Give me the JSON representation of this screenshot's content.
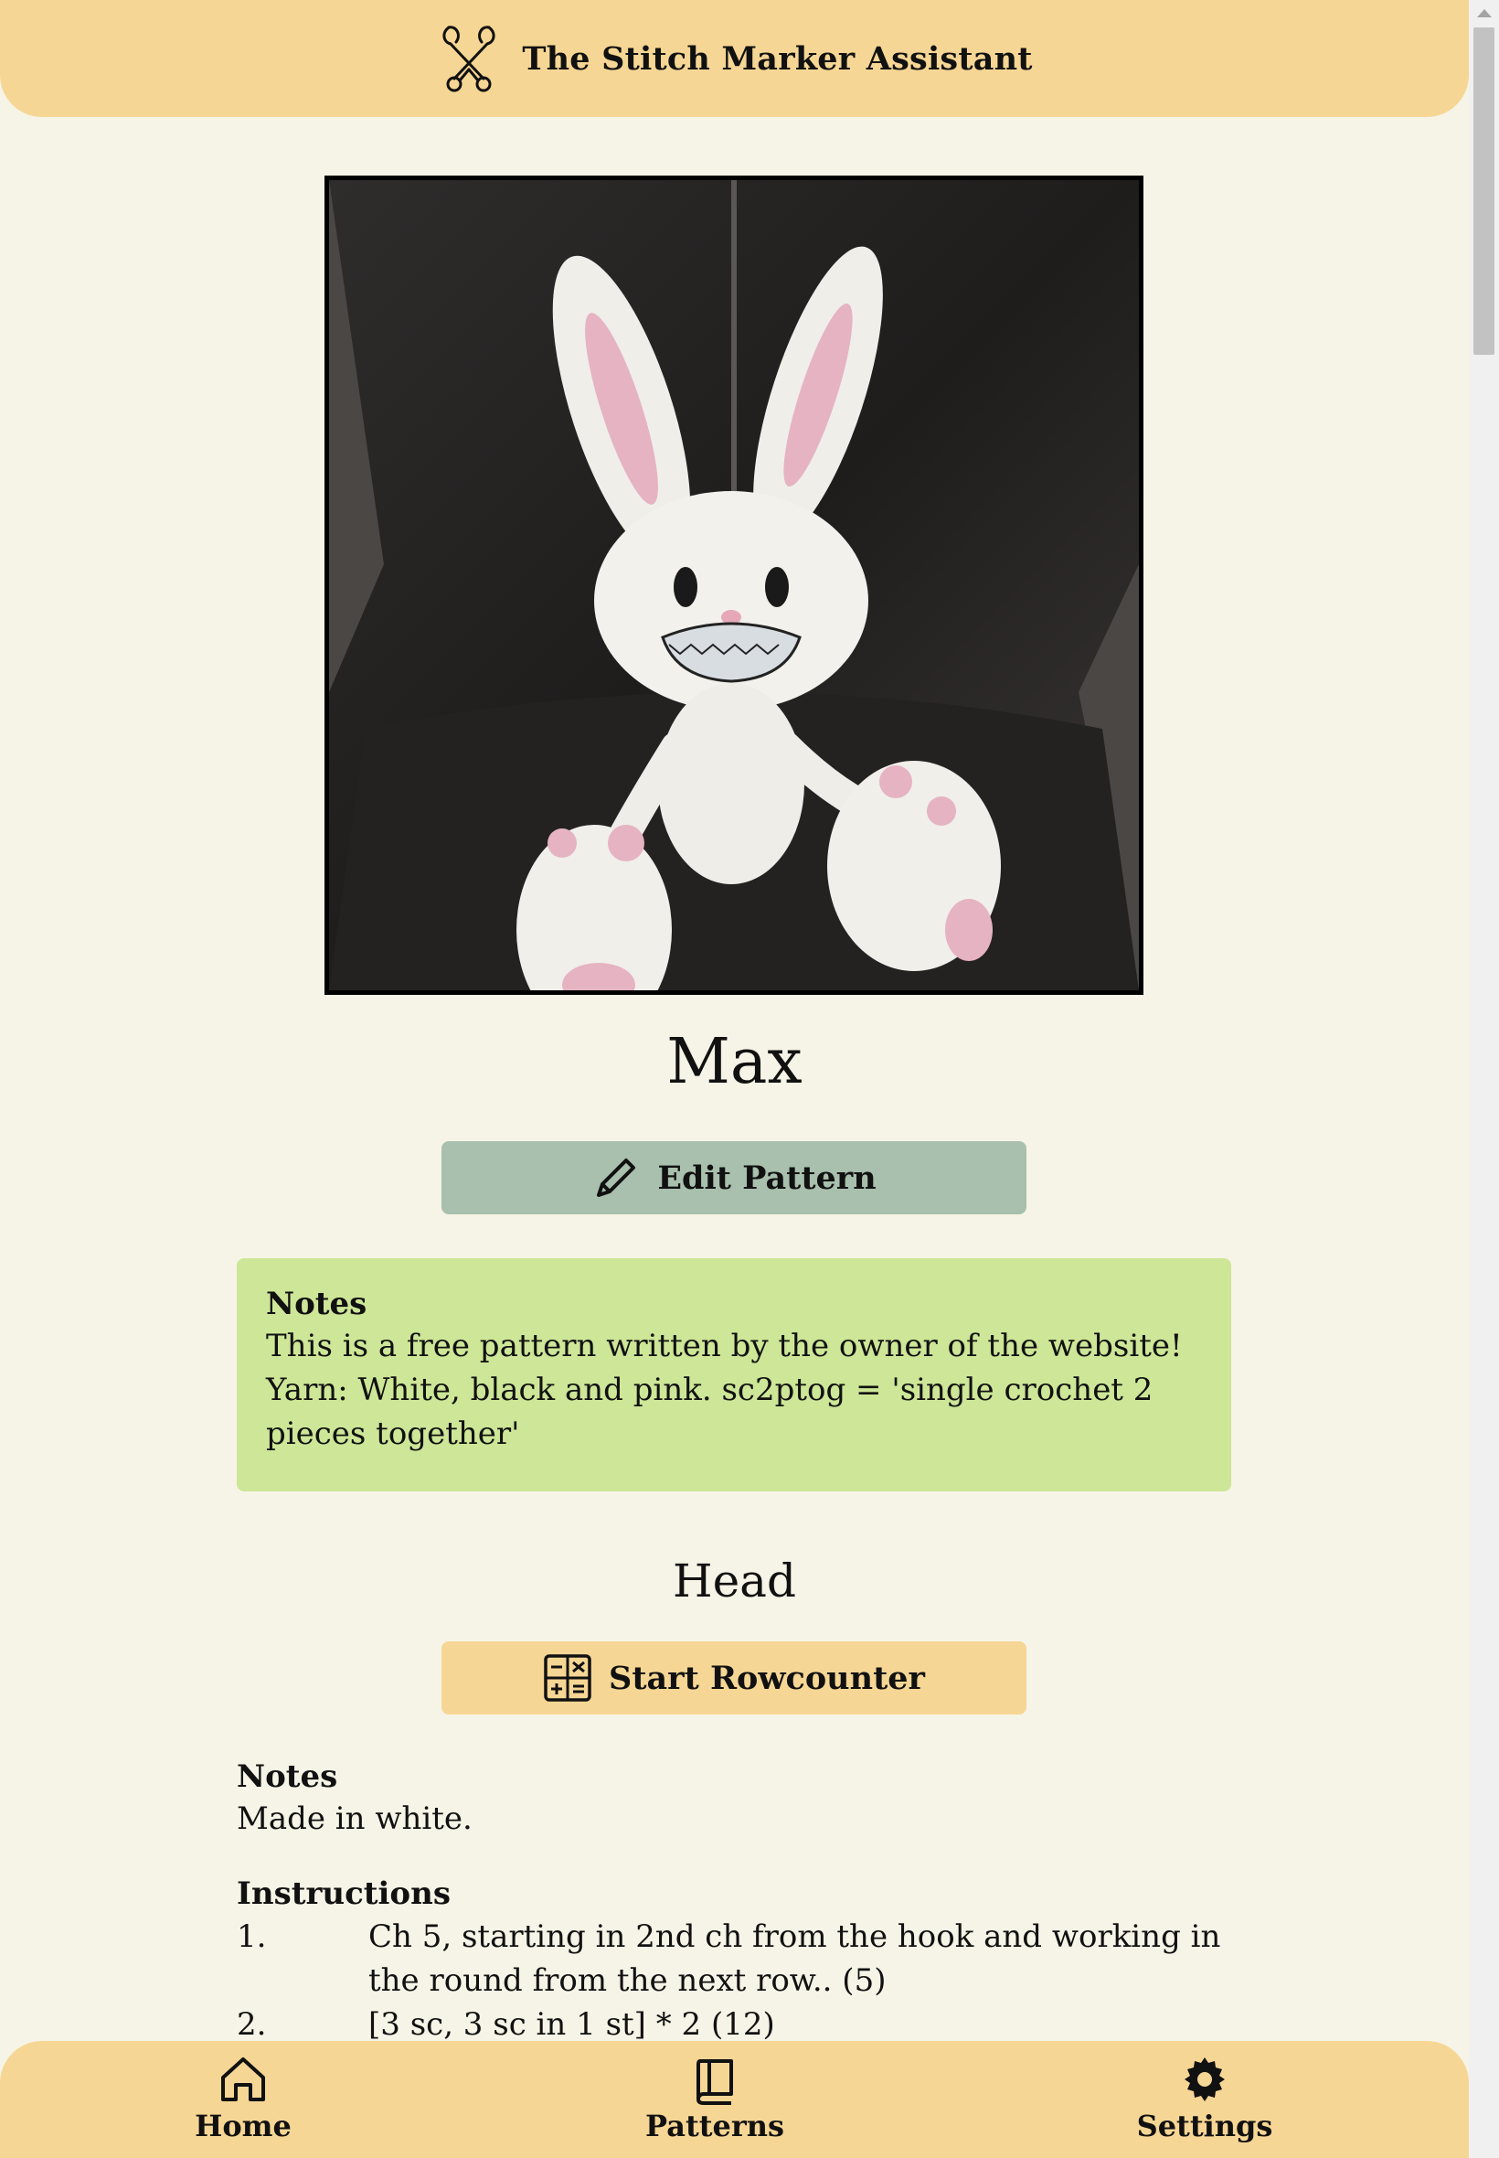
{
  "header": {
    "title": "The Stitch Marker Assistant",
    "logo_icon": "crossed-stitch-markers-icon"
  },
  "pattern": {
    "name": "Max",
    "edit_label": "Edit Pattern",
    "notes": {
      "heading": "Notes",
      "text": "This is a free pattern written by the owner of the website! Yarn: White, black and pink. sc2ptog = 'single crochet 2 pieces together'"
    }
  },
  "section": {
    "title": "Head",
    "rowcounter_label": "Start Rowcounter",
    "notes_heading": "Notes",
    "notes_text": "Made in white.",
    "instructions_heading": "Instructions",
    "instructions": [
      {
        "num": "1.",
        "text": "Ch 5, starting in 2nd ch from the hook and working in the round from the next row.. (5)"
      },
      {
        "num": "2.",
        "text": "[3 sc, 3 sc in 1 st] * 2 (12)"
      }
    ]
  },
  "nav": {
    "home": "Home",
    "patterns": "Patterns",
    "settings": "Settings"
  },
  "colors": {
    "background": "#f6f4e6",
    "header": "#f6d694",
    "edit_button": "#a8c0ad",
    "notes_card": "#cde697"
  }
}
